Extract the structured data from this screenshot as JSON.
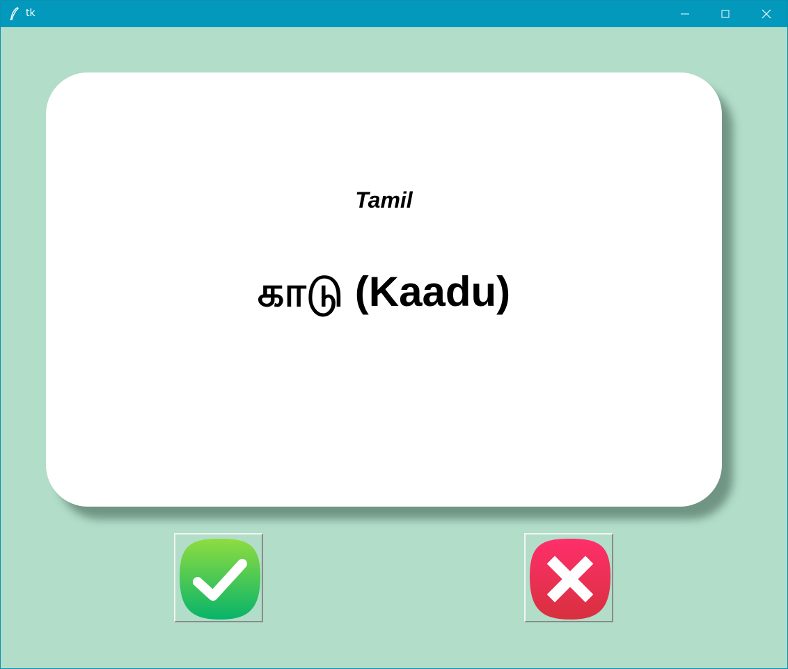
{
  "window": {
    "title": "tk"
  },
  "card": {
    "language": "Tamil",
    "word": "காடு (Kaadu)"
  },
  "buttons": {
    "right_icon": "checkmark-icon",
    "wrong_icon": "cross-icon"
  },
  "colors": {
    "background": "#b1ddc9",
    "titlebar": "#0399bd",
    "card": "#ffffff",
    "right_green": "#22c462",
    "wrong_red": "#ea2f55"
  }
}
